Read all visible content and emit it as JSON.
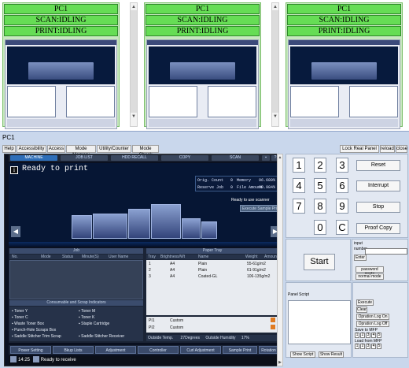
{
  "monitors": [
    {
      "title": "PC1",
      "scan_status": "SCAN:IDLING",
      "print_status": "PRINT:IDLING"
    },
    {
      "title": "PC1",
      "scan_status": "SCAN:IDLING",
      "print_status": "PRINT:IDLING"
    },
    {
      "title": "PC1",
      "scan_status": "SCAN:IDLING",
      "print_status": "PRINT:IDLING"
    }
  ],
  "detail": {
    "pc_label": "PC1",
    "menu": [
      "Help",
      "Accessibility",
      "Access",
      "Mode Memory",
      "Utility/Counter",
      "Mode Check"
    ],
    "right_menu": [
      "Lock Real Panel",
      "reload",
      "close"
    ]
  },
  "screen": {
    "tabs": [
      "MACHINE",
      "JOB LIST",
      "HDD RECALL",
      "COPY",
      "SCAN"
    ],
    "ready_text": "Ready to print",
    "counters": {
      "orig_count_label": "Orig. Count",
      "orig_count": "0",
      "memory_label": "Memory",
      "memory": "96.689%",
      "reserve_job_label": "Reserve Job",
      "reserve_job": "0",
      "file_amount_label": "File Amount",
      "file_amount": "98.984%"
    },
    "scanner_ready": "Ready to use scanner",
    "sample_button": "Execute Sample Print",
    "job_header": "Job",
    "job_columns": [
      "No.",
      "Mode",
      "Status",
      "Minute(S)",
      "User Name"
    ],
    "consumables_header": "Consumable and Scrap Indicators",
    "consumables_left": [
      "Toner Y",
      "Toner C",
      "Waste Toner Box",
      "Punch-Hole Scraps Box",
      "Saddle Stitcher Trim Scrap"
    ],
    "consumables_right": [
      "Toner M",
      "Toner K",
      "Staple Cartridge",
      "",
      "Saddle Stitcher Receiver"
    ],
    "tray_header": "Paper Tray",
    "tray_columns": [
      "Tray",
      "Brightness/Wt",
      "Name",
      "Weight",
      "Amount"
    ],
    "trays": [
      {
        "tray": "1",
        "size": "A4",
        "name": "Plain",
        "weight": "55-61g/m2"
      },
      {
        "tray": "2",
        "size": "A4",
        "name": "Plain",
        "weight": "61-91g/m2"
      },
      {
        "tray": "3",
        "size": "A4",
        "name": "Coated-GL",
        "weight": "106-135g/m2"
      }
    ],
    "pi_rows": [
      {
        "tray": "PI1",
        "name": "Custom"
      },
      {
        "tray": "PI2",
        "name": "Custom"
      }
    ],
    "outside_temp_label": "Outside Temp.",
    "outside_temp": "27Degrees",
    "outside_humidity_label": "Outside Humidity",
    "outside_humidity": "17%",
    "bottom_buttons": [
      "Power Setting",
      "Bkup Lists",
      "Adjustment",
      "Controller",
      "Curl Adjustment",
      "Sample Print"
    ],
    "bottom_right": "Rotation",
    "clock": "14:25",
    "status_text": "Ready to receive"
  },
  "control_panel": {
    "keys": [
      "1",
      "2",
      "3",
      "4",
      "5",
      "6",
      "7",
      "8",
      "9",
      "0",
      "C"
    ],
    "reset": "Reset",
    "interrupt": "Interrupt",
    "stop": "Stop",
    "proof_copy": "Proof Copy",
    "start": "Start",
    "input_label": "input",
    "number_label": "number",
    "enter": "Enter",
    "password_mode": "password mode",
    "normal_mode": "normal mode",
    "panel_script_label": "Panel Script",
    "execute": "Execute",
    "clear": "Clear",
    "operation_log_on": "Opration Log On",
    "operation_log_off": "Opration Log Off",
    "save_to_mfp": "Save to MFP",
    "load_from_mfp": "Load from MFP",
    "slot_numbers": [
      "1",
      "2",
      "3",
      "4",
      "5"
    ],
    "show_script": "Show Script",
    "show_result": "Show Result"
  }
}
